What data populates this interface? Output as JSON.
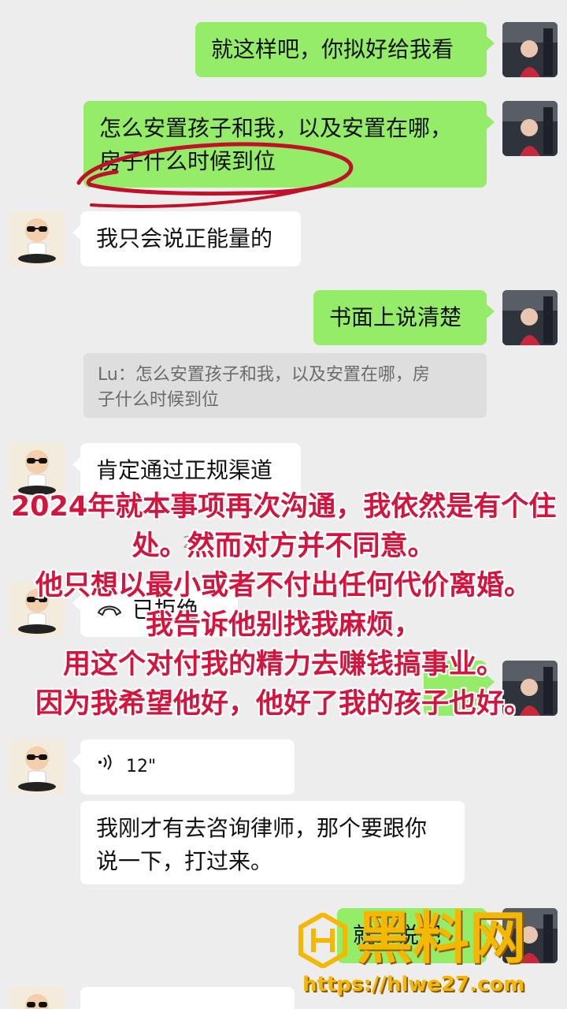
{
  "messages": {
    "m1": "就这样吧，你拟好给我看",
    "m2_line1": "怎么安置孩子和我，以及安置在哪，",
    "m2_line2": "房子什么时候到位",
    "m3": "我只会说正能量的",
    "m4": "书面上说清楚",
    "quote_line1": "Lu：怎么安置孩子和我，以及安置在哪，房",
    "quote_line2": "子什么时候到位",
    "m5": "肯定通过正规渠道",
    "call_status": "已拒绝",
    "voice_duration": "12\"",
    "m7_line1": "我刚才有去咨询律师，那个要跟你",
    "m7_line2": "说一下，打过来。",
    "m8_partial": "就…说吧",
    "m2_date_partial": "2"
  },
  "overlay": {
    "line1": "2024年就本事项再次沟通，我依然是有个住",
    "line2": "处。然而对方并不同意。",
    "line3": "他只想以最小或者不付出任何代价离婚。",
    "line4": "我告诉他别找我麻烦，",
    "line5": "用这个对付我的精力去赚钱搞事业。",
    "line6": "因为我希望他好，他好了我的孩子也好。"
  },
  "watermark": {
    "brand": "黑料网",
    "url": "https://hlwe27.com"
  },
  "colors": {
    "background": "#ededed",
    "sent_bubble": "#95ec69",
    "received_bubble": "#ffffff",
    "overlay_text": "#d4143c",
    "annotation_circle": "#c0102a",
    "watermark": "#f5b800"
  }
}
